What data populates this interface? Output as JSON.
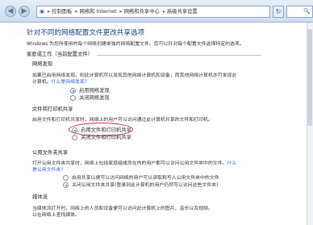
{
  "navigation": {
    "back_label": "◀",
    "forward_label": "▶",
    "breadcrumbs": [
      "控制面板",
      "网络和 Internet",
      "网络和共享中心",
      "高级共享设置"
    ],
    "refresh_label": "↻",
    "search_placeholder": "🔍"
  },
  "page": {
    "title": "针对不同的网络配置文件更改共享选项",
    "intro": "Windows 为您所使用的每个网络创建单独的网络配置文件。您可以针对每个配置文件选择特定的选项。"
  },
  "profile": {
    "name": "家庭或工作（当前配置文件）"
  },
  "network_discovery": {
    "heading": "网络发现",
    "desc_line1": "如果已启用网络发现，则此计算机可以发现其他网络计算机和设备，而其他网络计算机亦可发现此",
    "desc_line2_prefix": "计算机。",
    "link": "什么是网络发现?",
    "options": [
      "启用网络发现",
      "关闭网络发现"
    ]
  },
  "file_printer_sharing": {
    "heading": "文件和打印机共享",
    "desc": "启用文件和打印机共享时，网络上的用户可以访问通过此计算机共享的文件和打印机。",
    "options": [
      "启用文件和打印机共享",
      "关闭文件和打印机共享"
    ]
  },
  "public_folder_sharing": {
    "heading": "公用文件夹共享",
    "desc_line1_prefix": "打开公用文件夹共享时，网络上包括家庭组成员在内的用户都可以访问公用文件夹中的文件。",
    "desc_link_part1": "什么",
    "desc_link_part2": "是公用文件夹?",
    "options": [
      "启用共享以便可以访问网络的用户可以读取和写入公用文件夹中的文件",
      "关闭公用文件夹共享(登录到此计算机的用户仍然可以访问这些文件夹)"
    ]
  },
  "media_streaming": {
    "heading": "媒体流",
    "desc_line1": "当媒体流打开时，网络上的人员和设备便可以访问此计算机上的图片、音乐以及视频。",
    "desc_line2": "以在网络上查找媒体。"
  }
}
